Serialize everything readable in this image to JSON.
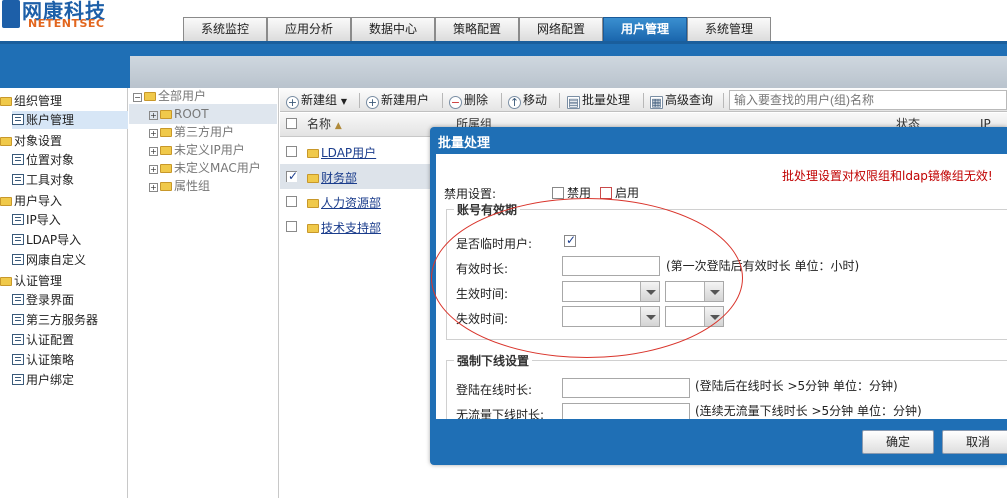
{
  "brand": {
    "name_cn": "网康科技",
    "name_en": "NETENTSEC"
  },
  "tabs": [
    {
      "label": "系统监控",
      "active": false
    },
    {
      "label": "应用分析",
      "active": false
    },
    {
      "label": "数据中心",
      "active": false
    },
    {
      "label": "策略配置",
      "active": false
    },
    {
      "label": "网络配置",
      "active": false
    },
    {
      "label": "用户管理",
      "active": true
    },
    {
      "label": "系统管理",
      "active": false
    }
  ],
  "sidebar": {
    "sections": [
      {
        "label": "组织管理",
        "items": [
          "账户管理"
        ]
      },
      {
        "label": "对象设置",
        "items": [
          "位置对象",
          "工具对象"
        ]
      },
      {
        "label": "用户导入",
        "items": [
          "IP导入",
          "LDAP导入",
          "网康自定义"
        ]
      },
      {
        "label": "认证管理",
        "items": [
          "登录界面",
          "第三方服务器",
          "认证配置",
          "认证策略",
          "用户绑定"
        ]
      }
    ],
    "selected": "账户管理"
  },
  "group_tree": {
    "root": "全部用户",
    "children": [
      "ROOT",
      "第三方用户",
      "未定义IP用户",
      "未定义MAC用户",
      "属性组"
    ]
  },
  "toolbar": {
    "new_group": "新建组",
    "new_user": "新建用户",
    "delete": "删除",
    "move": "移动",
    "batch": "批量处理",
    "advanced_query": "高级查询",
    "search_placeholder": "输入要查找的用户(组)名称"
  },
  "grid": {
    "columns": [
      "名称",
      "所属组",
      "状态",
      "IP"
    ],
    "rows": [
      {
        "name": "LDAP用户",
        "checked": false
      },
      {
        "name": "财务部",
        "checked": true
      },
      {
        "name": "人力资源部",
        "checked": false
      },
      {
        "name": "技术支持部",
        "checked": false
      }
    ]
  },
  "dialog": {
    "title": "批量处理",
    "warning": "批处理设置对权限组和ldap镜像组无效!",
    "disable_label": "禁用设置:",
    "opt_disable": "禁用",
    "opt_enable": "启用",
    "validity_legend": "账号有效期",
    "temp_user_label": "是否临时用户:",
    "temp_user_checked": true,
    "valid_duration_label": "有效时长:",
    "valid_duration_hint": "(第一次登陆后有效时长 单位：小时)",
    "valid_duration_value": "",
    "start_time_label": "生效时间:",
    "end_time_label": "失效时间:",
    "offline_legend": "强制下线设置",
    "online_duration_label": "登陆在线时长:",
    "online_duration_hint": "(登陆后在线时长 >5分钟 单位：分钟)",
    "idle_duration_label": "无流量下线时长:",
    "idle_duration_hint": "(连续无流量下线时长 >5分钟 单位：分钟)",
    "ok_label": "确定",
    "cancel_label": "取消"
  },
  "colors": {
    "header_blue": "#1f6fb5",
    "active_tab": "#1a66ad",
    "warning_red": "#c00000",
    "annotation_red": "#d9342b"
  }
}
